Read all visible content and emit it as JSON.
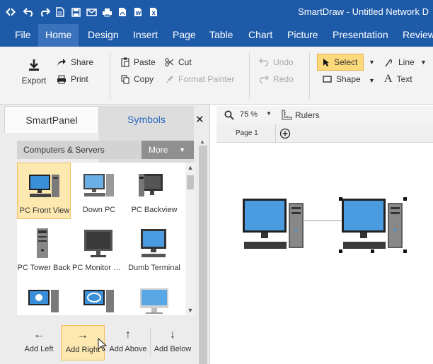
{
  "app": {
    "title": "SmartDraw - Untitled Network D",
    "brand_color": "#1d5aa8"
  },
  "qat_icons": [
    "smartdraw-logo-icon",
    "undo-icon",
    "redo-icon",
    "new-document-icon",
    "save-icon",
    "email-icon",
    "print-icon",
    "pdf-icon",
    "word-icon",
    "excel-icon"
  ],
  "menu": {
    "items": [
      "File",
      "Home",
      "Design",
      "Insert",
      "Page",
      "Table",
      "Chart",
      "Picture",
      "Presentation",
      "Review"
    ],
    "active": "Home"
  },
  "ribbon": {
    "export": "Export",
    "share": "Share",
    "print": "Print",
    "paste": "Paste",
    "copy": "Copy",
    "cut": "Cut",
    "format_painter": "Format Painter",
    "undo": "Undo",
    "redo": "Redo",
    "select": "Select",
    "shape": "Shape",
    "line": "Line",
    "text": "Text"
  },
  "panel": {
    "tabs": [
      "SmartPanel",
      "Symbols"
    ],
    "active_tab": "Symbols",
    "library_name": "Computers & Servers",
    "more_label": "More",
    "symbols": [
      {
        "label": "PC Front View",
        "selected": true
      },
      {
        "label": "Down PC",
        "selected": false
      },
      {
        "label": "PC Backview",
        "selected": false
      },
      {
        "label": "PC Tower Back",
        "selected": false
      },
      {
        "label": "PC Monitor Back",
        "selected": false
      },
      {
        "label": "Dumb Terminal",
        "selected": false
      },
      {
        "label": "",
        "selected": false
      },
      {
        "label": "",
        "selected": false
      },
      {
        "label": "",
        "selected": false
      }
    ],
    "add_buttons": [
      "Add Left",
      "Add Right",
      "Add Above",
      "Add Below"
    ],
    "highlighted_add": "Add Right"
  },
  "canvas": {
    "zoom": "75 %",
    "rulers_label": "Rulers",
    "page_tab": "Page 1"
  }
}
